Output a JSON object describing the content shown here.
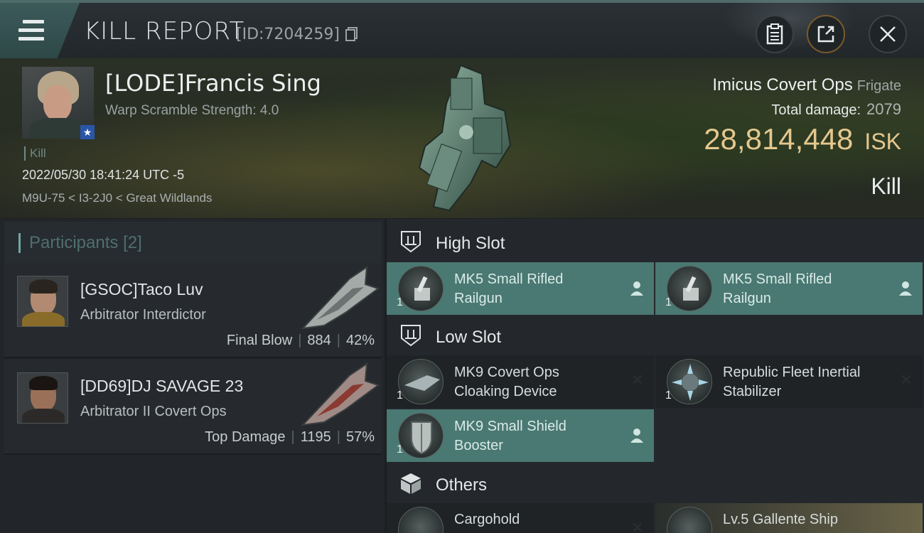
{
  "header": {
    "title": "KILL REPORT",
    "report_id": "[ID:7204259]"
  },
  "victim": {
    "pilot_name": "[LODE]Francis Sing",
    "warp_scramble": "Warp Scramble Strength: 4.0",
    "tag": "Kill",
    "datetime": "2022/05/30 18:41:24 UTC -5",
    "location": "M9U-75 < I3-2J0 < Great Wildlands",
    "ship_name": "Imicus Covert Ops",
    "ship_class": "Frigate",
    "total_damage_label": "Total damage:",
    "total_damage_value": "2079",
    "isk_value": "28,814,448",
    "isk_unit": "ISK",
    "result": "Kill"
  },
  "participants": {
    "label": "Participants",
    "count": "[2]",
    "rows": [
      {
        "name": "[GSOC]Taco Luv",
        "ship": "Arbitrator Interdictor",
        "role": "Final Blow",
        "damage": "884",
        "percent": "42%"
      },
      {
        "name": "[DD69]DJ SAVAGE 23",
        "ship": "Arbitrator II Covert Ops",
        "role": "Top Damage",
        "damage": "1195",
        "percent": "57%"
      }
    ]
  },
  "fitting": {
    "high_slot_label": "High Slot",
    "low_slot_label": "Low Slot",
    "others_label": "Others",
    "high": [
      {
        "qty": "1",
        "name_line1": "MK5 Small Rifled",
        "name_line2": "Railgun"
      },
      {
        "qty": "1",
        "name_line1": "MK5 Small Rifled",
        "name_line2": "Railgun"
      }
    ],
    "low": [
      {
        "qty": "1",
        "name_line1": "MK9 Covert Ops",
        "name_line2": "Cloaking Device"
      },
      {
        "qty": "1",
        "name_line1": "Republic Fleet Inertial",
        "name_line2": "Stabilizer"
      },
      {
        "qty": "1",
        "name_line1": "MK9 Small Shield",
        "name_line2": "Booster"
      }
    ],
    "others": [
      {
        "name": "Cargohold"
      },
      {
        "name": "Lv.5 Gallente Ship"
      }
    ]
  },
  "colors": {
    "accent_teal": "#4a7872",
    "isk_gold": "#e5c78e"
  }
}
